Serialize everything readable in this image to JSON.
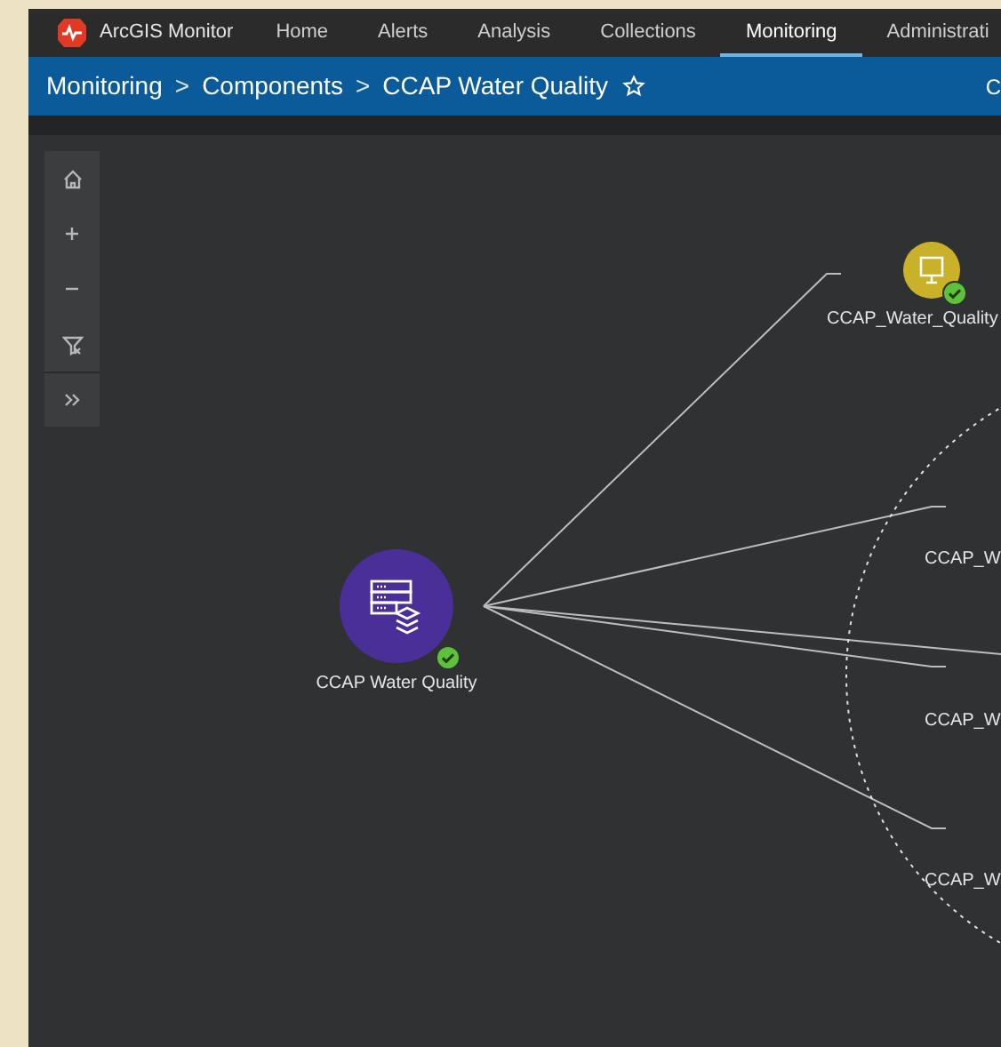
{
  "nav": {
    "brand": "ArcGIS Monitor",
    "items": [
      {
        "label": "Home",
        "selected": false
      },
      {
        "label": "Alerts",
        "selected": false
      },
      {
        "label": "Analysis",
        "selected": false
      },
      {
        "label": "Collections",
        "selected": false
      },
      {
        "label": "Monitoring",
        "selected": true
      },
      {
        "label": "Administrati",
        "selected": false
      }
    ]
  },
  "breadcrumb": {
    "items": [
      "Monitoring",
      "Components",
      "CCAP Water Quality"
    ],
    "separator": ">",
    "favorite": false,
    "right_text": "C"
  },
  "tools": [
    {
      "kind": "home"
    },
    {
      "kind": "zoom-in"
    },
    {
      "kind": "zoom-out"
    },
    {
      "kind": "filter"
    },
    {
      "kind": "expand"
    }
  ],
  "graph": {
    "center": {
      "label": "CCAP Water Quality",
      "healthy": true
    },
    "nodes": [
      {
        "label": "CCAP_Water_Quality",
        "kind": "server",
        "healthy": true
      },
      {
        "label": "CCAP_W",
        "kind": "label"
      },
      {
        "label": "CCAP_W",
        "kind": "label"
      },
      {
        "label": "CCAP_W",
        "kind": "label"
      }
    ]
  }
}
